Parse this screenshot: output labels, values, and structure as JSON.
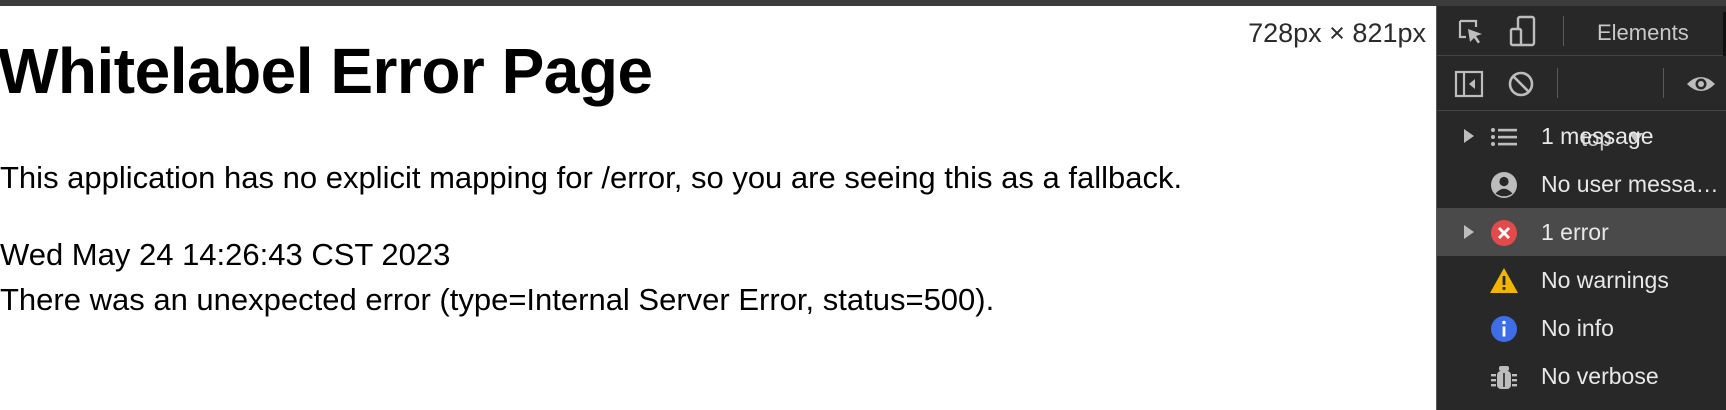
{
  "page": {
    "title": "Whitelabel Error Page",
    "message": "This application has no explicit mapping for /error, so you are seeing this as a fallback.",
    "timestamp": "Wed May 24 14:26:43 CST 2023",
    "error_detail": "There was an unexpected error (type=Internal Server Error, status=500).",
    "viewport_size": "728px × 821px"
  },
  "devtools": {
    "tabs": {
      "elements": "Elements"
    },
    "context": "top",
    "icons": [
      "inspect-element-icon",
      "device-toolbar-icon",
      "sidebar-toggle-icon",
      "clear-console-icon",
      "live-expression-eye-icon"
    ],
    "sidebar": [
      {
        "label": "1 message",
        "icon": "list-icon",
        "expandable": true,
        "selected": false
      },
      {
        "label": "No user messa…",
        "icon": "user-icon",
        "expandable": false,
        "selected": false
      },
      {
        "label": "1 error",
        "icon": "error-icon",
        "expandable": true,
        "selected": true
      },
      {
        "label": "No warnings",
        "icon": "warning-icon",
        "expandable": false,
        "selected": false
      },
      {
        "label": "No info",
        "icon": "info-icon",
        "expandable": false,
        "selected": false
      },
      {
        "label": "No verbose",
        "icon": "bug-icon",
        "expandable": false,
        "selected": false
      }
    ],
    "colors": {
      "panel_bg": "#282828",
      "selected_row": "#4a4a4a",
      "error": "#e34b4b",
      "warning": "#f2b600",
      "info": "#3d6ee8"
    }
  }
}
